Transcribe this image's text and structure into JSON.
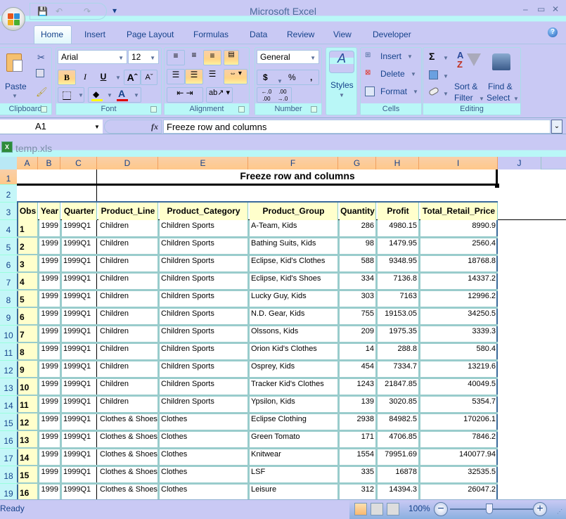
{
  "window": {
    "title": "Microsoft Excel",
    "controls": {
      "minimize": "–",
      "restore": "▭",
      "close": "✕"
    }
  },
  "qat": {
    "save_icon": "💾",
    "undo_icon": "↶",
    "redo_icon": "↷",
    "customize_icon": "▾"
  },
  "tabs": [
    "Home",
    "Insert",
    "Page Layout",
    "Formulas",
    "Data",
    "Review",
    "View",
    "Developer"
  ],
  "ribbon": {
    "clipboard": {
      "label": "Clipboard",
      "paste": "Paste"
    },
    "font": {
      "label": "Font",
      "font_name": "Arial",
      "font_size": "12",
      "bold": "B",
      "italic": "I",
      "underline": "U",
      "grow": "Aˆ",
      "shrink": "Aˇ",
      "font_color": "A"
    },
    "alignment": {
      "label": "Alignment"
    },
    "number": {
      "label": "Number",
      "format": "General",
      "currency": "$",
      "percent": "%",
      "comma": ",",
      "inc_decimal": "←.0 .00",
      "dec_decimal": ".00 →.0"
    },
    "styles": {
      "label": "Styles"
    },
    "cells": {
      "label": "Cells",
      "insert": "Insert",
      "delete": "Delete",
      "format": "Format"
    },
    "editing": {
      "label": "Editing",
      "autosum": "Σ",
      "sort_filter_1": "Sort &",
      "sort_filter_2": "Filter",
      "find_select_1": "Find &",
      "find_select_2": "Select"
    }
  },
  "formula_bar": {
    "name_box": "A1",
    "fx": "fx",
    "formula": "Freeze row and columns"
  },
  "workbook": {
    "title": "temp.xls"
  },
  "sheet": {
    "columns": [
      "A",
      "B",
      "C",
      "D",
      "E",
      "F",
      "G",
      "H",
      "I",
      "J"
    ],
    "rows": [
      "1",
      "2",
      "3",
      "4",
      "5",
      "6",
      "7",
      "8",
      "9",
      "10",
      "11",
      "12",
      "13",
      "14",
      "15",
      "16",
      "17",
      "18",
      "19"
    ],
    "title": "Freeze row and columns",
    "headers": [
      "Obs",
      "Year",
      "Quarter",
      "Product_Line",
      "Product_Category",
      "Product_Group",
      "Quantity",
      "Profit",
      "Total_Retail_Price"
    ],
    "data": [
      [
        "1",
        "1999",
        "1999Q1",
        "Children",
        "Children Sports",
        "A-Team, Kids",
        "286",
        "4980.15",
        "8990.9"
      ],
      [
        "2",
        "1999",
        "1999Q1",
        "Children",
        "Children Sports",
        "Bathing Suits, Kids",
        "98",
        "1479.95",
        "2560.4"
      ],
      [
        "3",
        "1999",
        "1999Q1",
        "Children",
        "Children Sports",
        "Eclipse, Kid's Clothes",
        "588",
        "9348.95",
        "18768.8"
      ],
      [
        "4",
        "1999",
        "1999Q1",
        "Children",
        "Children Sports",
        "Eclipse, Kid's Shoes",
        "334",
        "7136.8",
        "14337.2"
      ],
      [
        "5",
        "1999",
        "1999Q1",
        "Children",
        "Children Sports",
        "Lucky Guy, Kids",
        "303",
        "7163",
        "12996.2"
      ],
      [
        "6",
        "1999",
        "1999Q1",
        "Children",
        "Children Sports",
        "N.D. Gear, Kids",
        "755",
        "19153.05",
        "34250.5"
      ],
      [
        "7",
        "1999",
        "1999Q1",
        "Children",
        "Children Sports",
        "Olssons, Kids",
        "209",
        "1975.35",
        "3339.3"
      ],
      [
        "8",
        "1999",
        "1999Q1",
        "Children",
        "Children Sports",
        "Orion Kid's Clothes",
        "14",
        "288.8",
        "580.4"
      ],
      [
        "9",
        "1999",
        "1999Q1",
        "Children",
        "Children Sports",
        "Osprey, Kids",
        "454",
        "7334.7",
        "13219.6"
      ],
      [
        "10",
        "1999",
        "1999Q1",
        "Children",
        "Children Sports",
        "Tracker Kid's Clothes",
        "1243",
        "21847.85",
        "40049.5"
      ],
      [
        "11",
        "1999",
        "1999Q1",
        "Children",
        "Children Sports",
        "Ypsilon, Kids",
        "139",
        "3020.85",
        "5354.7"
      ],
      [
        "12",
        "1999",
        "1999Q1",
        "Clothes & Shoes",
        "Clothes",
        "Eclipse Clothing",
        "2938",
        "84982.5",
        "170206.1"
      ],
      [
        "13",
        "1999",
        "1999Q1",
        "Clothes & Shoes",
        "Clothes",
        "Green Tomato",
        "171",
        "4706.85",
        "7846.2"
      ],
      [
        "14",
        "1999",
        "1999Q1",
        "Clothes & Shoes",
        "Clothes",
        "Knitwear",
        "1554",
        "79951.69",
        "140077.94"
      ],
      [
        "15",
        "1999",
        "1999Q1",
        "Clothes & Shoes",
        "Clothes",
        "LSF",
        "335",
        "16878",
        "32535.5"
      ],
      [
        "16",
        "1999",
        "1999Q1",
        "Clothes & Shoes",
        "Clothes",
        "Leisure",
        "312",
        "14394.3",
        "26047.2"
      ]
    ]
  },
  "status": {
    "text": "Ready",
    "zoom": "100%",
    "zoom_minus": "−",
    "zoom_plus": "+"
  }
}
